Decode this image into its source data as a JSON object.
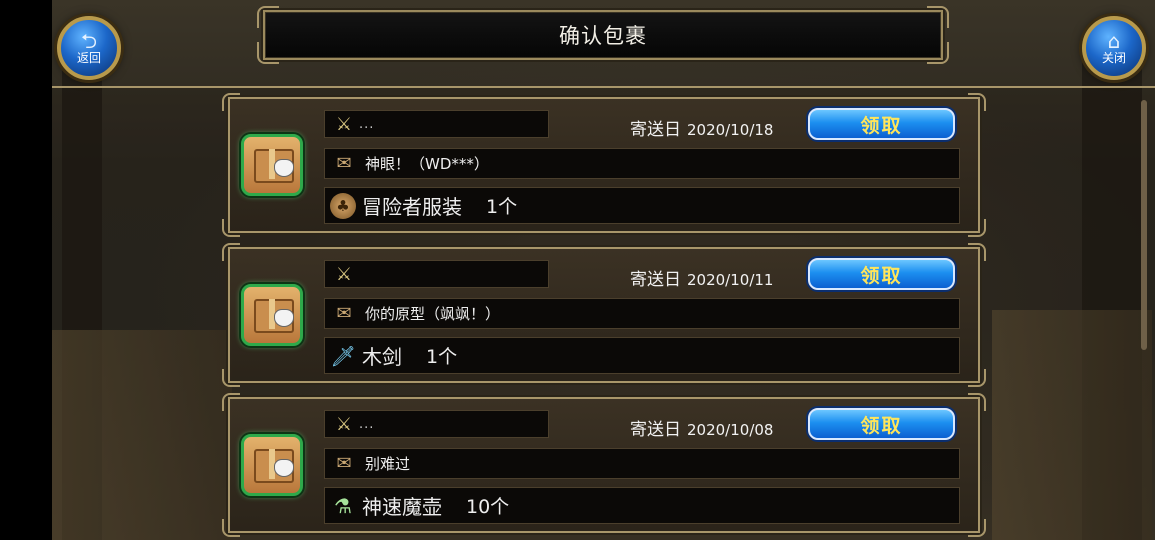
{
  "header": {
    "title": "确认包裹",
    "back_label": "返回",
    "close_label": "关闭"
  },
  "cards": [
    {
      "sender": "...",
      "date_prefix": "寄送日",
      "date": "2020/10/18",
      "claim_label": "领取",
      "message": "神眼！（WD***）",
      "item_name": "冒险者服装",
      "item_qty": "1个",
      "item_icon": "costume-icon"
    },
    {
      "sender": "",
      "date_prefix": "寄送日",
      "date": "2020/10/11",
      "claim_label": "领取",
      "message": "你的原型（飒飒！）",
      "item_name": "木剑",
      "item_qty": "1个",
      "item_icon": "sword-icon"
    },
    {
      "sender": "...",
      "date_prefix": "寄送日",
      "date": "2020/10/08",
      "claim_label": "领取",
      "message": "别难过",
      "item_name": "神速魔壶",
      "item_qty": "10个",
      "item_icon": "potion-icon"
    }
  ],
  "colors": {
    "claim_text": "#ffe55a",
    "claim_button": "#1c8ff0",
    "frame_gold": "#a8966a",
    "package_border": "#2ea94a"
  }
}
